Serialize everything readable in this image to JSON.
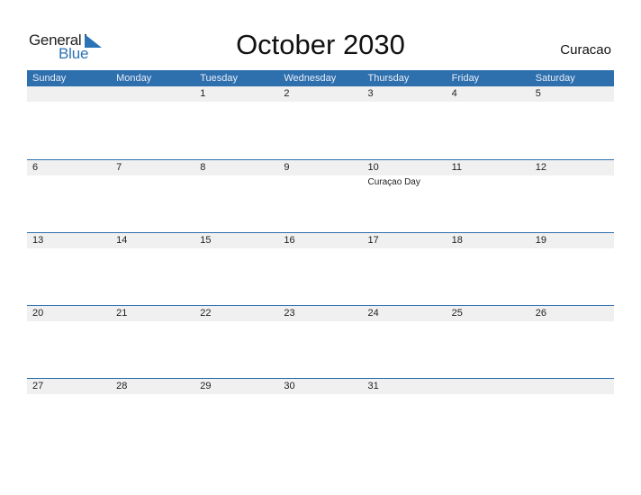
{
  "logo": {
    "line1": "General",
    "line2": "Blue"
  },
  "title": "October 2030",
  "country": "Curacao",
  "colors": {
    "accent": "#2e6fae",
    "logo_blue": "#2c73b5",
    "row_strip": "#f0f0f0"
  },
  "weekdays": [
    "Sunday",
    "Monday",
    "Tuesday",
    "Wednesday",
    "Thursday",
    "Friday",
    "Saturday"
  ],
  "weeks": [
    [
      {
        "day": ""
      },
      {
        "day": ""
      },
      {
        "day": "1"
      },
      {
        "day": "2"
      },
      {
        "day": "3"
      },
      {
        "day": "4"
      },
      {
        "day": "5"
      }
    ],
    [
      {
        "day": "6"
      },
      {
        "day": "7"
      },
      {
        "day": "8"
      },
      {
        "day": "9"
      },
      {
        "day": "10",
        "event": "Curaçao Day"
      },
      {
        "day": "11"
      },
      {
        "day": "12"
      }
    ],
    [
      {
        "day": "13"
      },
      {
        "day": "14"
      },
      {
        "day": "15"
      },
      {
        "day": "16"
      },
      {
        "day": "17"
      },
      {
        "day": "18"
      },
      {
        "day": "19"
      }
    ],
    [
      {
        "day": "20"
      },
      {
        "day": "21"
      },
      {
        "day": "22"
      },
      {
        "day": "23"
      },
      {
        "day": "24"
      },
      {
        "day": "25"
      },
      {
        "day": "26"
      }
    ],
    [
      {
        "day": "27"
      },
      {
        "day": "28"
      },
      {
        "day": "29"
      },
      {
        "day": "30"
      },
      {
        "day": "31"
      },
      {
        "day": ""
      },
      {
        "day": ""
      }
    ]
  ]
}
